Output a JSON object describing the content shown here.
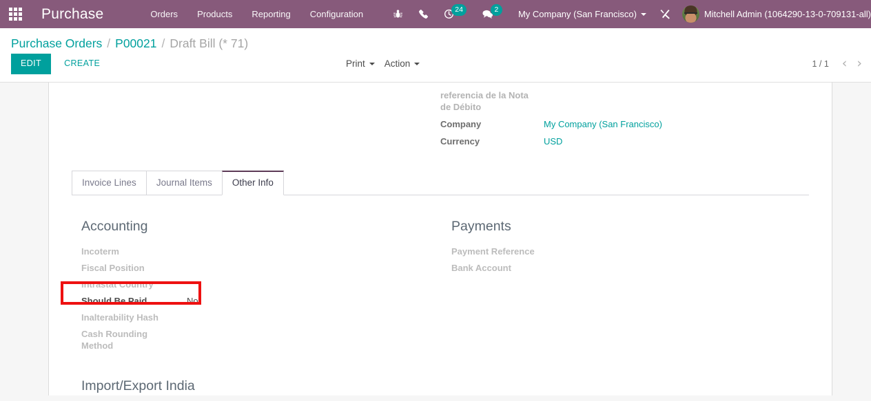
{
  "navbar": {
    "apps_icon": "apps-grid-icon",
    "brand": "Purchase",
    "menu": [
      {
        "label": "Orders"
      },
      {
        "label": "Products"
      },
      {
        "label": "Reporting"
      },
      {
        "label": "Configuration"
      }
    ],
    "icons": [
      {
        "name": "bug-icon",
        "label": ""
      },
      {
        "name": "phone-icon",
        "label": ""
      }
    ],
    "activity_badge": "24",
    "messages_badge": "2",
    "company": "My Company (San Francisco)",
    "tools_icon": "wrench-screwdriver-icon",
    "user": "Mitchell Admin (1064290-13-0-709131-all)",
    "accent": "#875a7b",
    "badge_color": "#00a09d"
  },
  "control_panel": {
    "breadcrumb": {
      "root": "Purchase Orders",
      "sep1": "/",
      "parent": "P00021",
      "sep2": "/",
      "current": "Draft Bill (* 71)"
    },
    "edit_label": "EDIT",
    "create_label": "CREATE",
    "print_label": "Print",
    "action_label": "Action",
    "pager": {
      "counter": "1 / 1",
      "prev": "‹",
      "next": "›"
    }
  },
  "form": {
    "top_right": [
      {
        "label": "referencia de la Nota de Débito",
        "value": "",
        "muted": true,
        "link": false
      },
      {
        "label": "Company",
        "value": "My Company (San Francisco)",
        "muted": false,
        "link": true
      },
      {
        "label": "Currency",
        "value": "USD",
        "muted": false,
        "link": true
      }
    ]
  },
  "tabs": [
    {
      "label": "Invoice Lines",
      "active": false
    },
    {
      "label": "Journal Items",
      "active": false
    },
    {
      "label": "Other Info",
      "active": true
    }
  ],
  "other_info": {
    "accounting": {
      "title": "Accounting",
      "fields": [
        {
          "label": "Incoterm",
          "value": "",
          "filled": false
        },
        {
          "label": "Fiscal Position",
          "value": "",
          "filled": false
        },
        {
          "label": "Intrastat Country",
          "value": "",
          "filled": false
        },
        {
          "label": "Should Be Paid",
          "value": "No",
          "filled": true
        },
        {
          "label": "Inalterability Hash",
          "value": "",
          "filled": false
        },
        {
          "label": "Cash Rounding Method",
          "value": "",
          "filled": false
        }
      ]
    },
    "payments": {
      "title": "Payments",
      "fields": [
        {
          "label": "Payment Reference",
          "value": "",
          "filled": false
        },
        {
          "label": "Bank Account",
          "value": "",
          "filled": false
        }
      ]
    },
    "import_export": {
      "title": "Import/Export India"
    }
  },
  "annotation": {
    "highlight_color": "#ee1111",
    "target_field": "Should Be Paid"
  }
}
